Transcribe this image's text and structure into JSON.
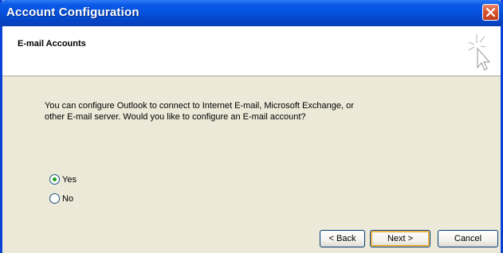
{
  "window": {
    "title": "Account Configuration",
    "title_bar_color": "#0553e0",
    "close_icon": "close-icon"
  },
  "header": {
    "title": "E-mail Accounts",
    "icon": "wizard-sparkle-cursor-icon"
  },
  "body": {
    "description_line1": "You can configure Outlook to connect to Internet E-mail, Microsoft Exchange, or",
    "description_line2": "other E-mail server. Would you like to configure an E-mail account?"
  },
  "options": {
    "selected": "Yes",
    "yes_label": "Yes",
    "no_label": "No"
  },
  "buttons": {
    "back_label": "< Back",
    "next_label": "Next >",
    "cancel_label": "Cancel"
  }
}
